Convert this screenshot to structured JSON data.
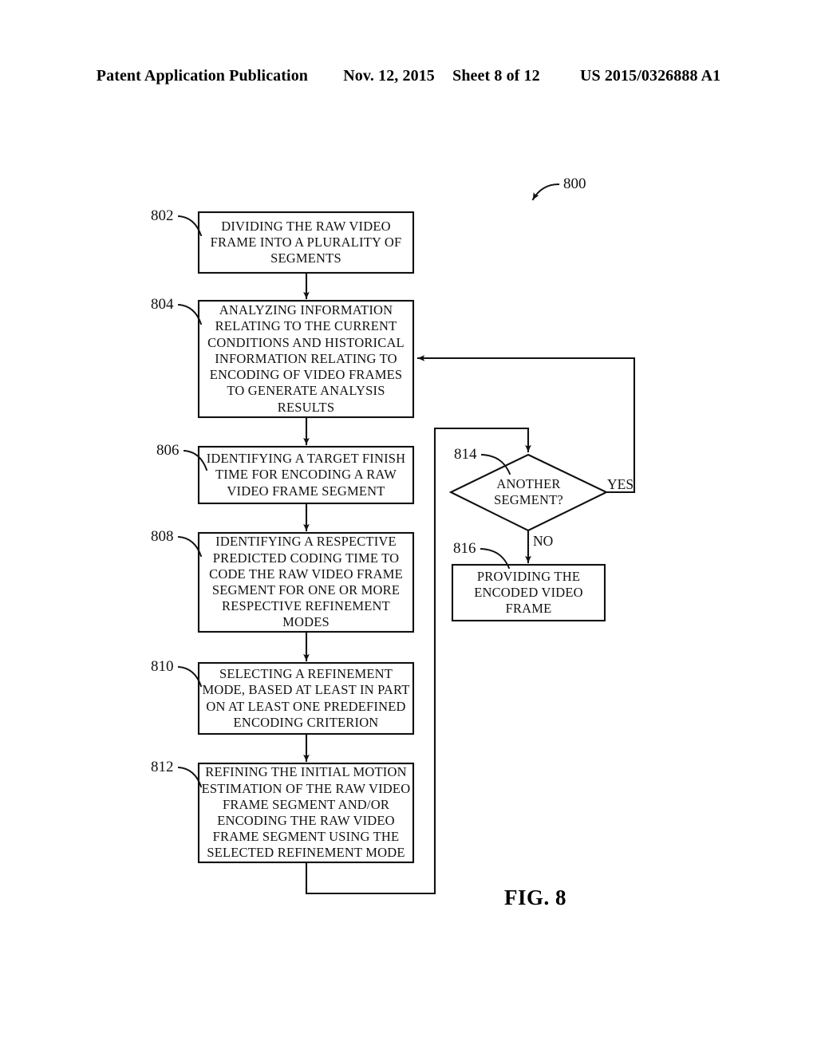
{
  "page": {
    "header": {
      "publication": "Patent Application Publication",
      "date": "Nov. 12, 2015",
      "sheet": "Sheet 8 of 12",
      "doc_number": "US 2015/0326888 A1"
    },
    "figure_caption": "FIG. 8",
    "figure_ref": "800",
    "ink_color": "#111111",
    "background_color": "#ffffff"
  },
  "flowchart": {
    "nodes": [
      {
        "ref": "802",
        "shape": "rect",
        "lines": [
          "DIVIDING THE RAW VIDEO",
          "FRAME INTO A PLURALITY OF",
          "SEGMENTS"
        ]
      },
      {
        "ref": "804",
        "shape": "rect",
        "lines": [
          "ANALYZING INFORMATION",
          "RELATING TO THE CURRENT",
          "CONDITIONS AND HISTORICAL",
          "INFORMATION RELATING TO",
          "ENCODING OF VIDEO FRAMES",
          "TO GENERATE ANALYSIS",
          "RESULTS"
        ]
      },
      {
        "ref": "806",
        "shape": "rect",
        "lines": [
          "IDENTIFYING A TARGET FINISH",
          "TIME FOR ENCODING A RAW",
          "VIDEO FRAME SEGMENT"
        ]
      },
      {
        "ref": "808",
        "shape": "rect",
        "lines": [
          "IDENTIFYING A RESPECTIVE",
          "PREDICTED CODING TIME TO",
          "CODE THE RAW VIDEO FRAME",
          "SEGMENT FOR ONE OR MORE",
          "RESPECTIVE REFINEMENT",
          "MODES"
        ]
      },
      {
        "ref": "810",
        "shape": "rect",
        "lines": [
          "SELECTING A REFINEMENT",
          "MODE, BASED AT LEAST IN PART",
          "ON AT LEAST ONE PREDEFINED",
          "ENCODING CRITERION"
        ]
      },
      {
        "ref": "812",
        "shape": "rect",
        "lines": [
          "REFINING THE INITIAL MOTION",
          "ESTIMATION OF THE RAW VIDEO",
          "FRAME SEGMENT AND/OR",
          "ENCODING THE RAW VIDEO",
          "FRAME SEGMENT USING THE",
          "SELECTED REFINEMENT MODE"
        ]
      },
      {
        "ref": "814",
        "shape": "diamond",
        "lines": [
          "ANOTHER",
          "SEGMENT?"
        ]
      },
      {
        "ref": "816",
        "shape": "rect",
        "lines": [
          "PROVIDING THE",
          "ENCODED VIDEO",
          "FRAME"
        ]
      }
    ],
    "edge_labels": {
      "yes": "YES",
      "no": "NO"
    }
  }
}
